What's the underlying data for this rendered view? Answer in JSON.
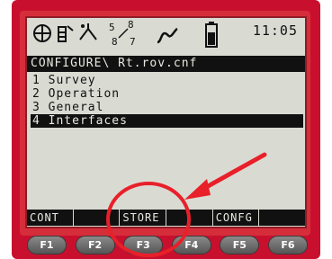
{
  "status": {
    "time": "11:05",
    "icons": [
      "target-icon",
      "prism-icon",
      "antenna-icon",
      "satellite-count-icon",
      "signal-icon",
      "battery-icon"
    ],
    "sat_top_left": "5",
    "sat_top_right": "8",
    "sat_bottom_left": "8",
    "sat_bottom_right": "7"
  },
  "path": "CONFIGURE\\ Rt.rov.cnf",
  "menu": [
    {
      "label": "1 Survey"
    },
    {
      "label": "2 Operation"
    },
    {
      "label": "3 General"
    },
    {
      "label": "4 Interfaces"
    }
  ],
  "softkeys": [
    "CONT",
    "",
    "STORE",
    "",
    "CONFG",
    ""
  ],
  "fkeys": [
    "F1",
    "F2",
    "F3",
    "F4",
    "F5",
    "F6"
  ],
  "colors": {
    "device": "#c8102e",
    "screen": "#d9dbd3",
    "annotation": "#e8202a"
  }
}
